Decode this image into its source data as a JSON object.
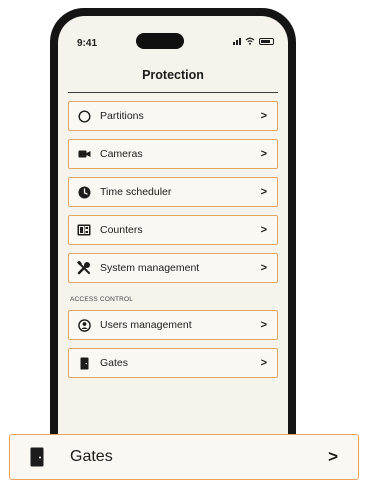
{
  "status_bar": {
    "time": "9:41"
  },
  "header": {
    "title": "Protection"
  },
  "menu": {
    "items": [
      {
        "label": "Partitions",
        "icon": "circle-icon"
      },
      {
        "label": "Cameras",
        "icon": "camera-icon"
      },
      {
        "label": "Time scheduler",
        "icon": "clock-icon"
      },
      {
        "label": "Counters",
        "icon": "counter-icon"
      },
      {
        "label": "System management",
        "icon": "tools-icon"
      }
    ],
    "section_label": "ACCESS CONTROL",
    "access_items": [
      {
        "label": "Users management",
        "icon": "user-icon"
      },
      {
        "label": "Gates",
        "icon": "gate-icon"
      }
    ],
    "chevron": ">"
  },
  "zoom": {
    "label": "Gates",
    "icon": "gate-icon",
    "chevron": ">"
  },
  "colors": {
    "accent_border": "#e2a565",
    "screen_bg": "#f6f3ed",
    "frame": "#141414"
  }
}
